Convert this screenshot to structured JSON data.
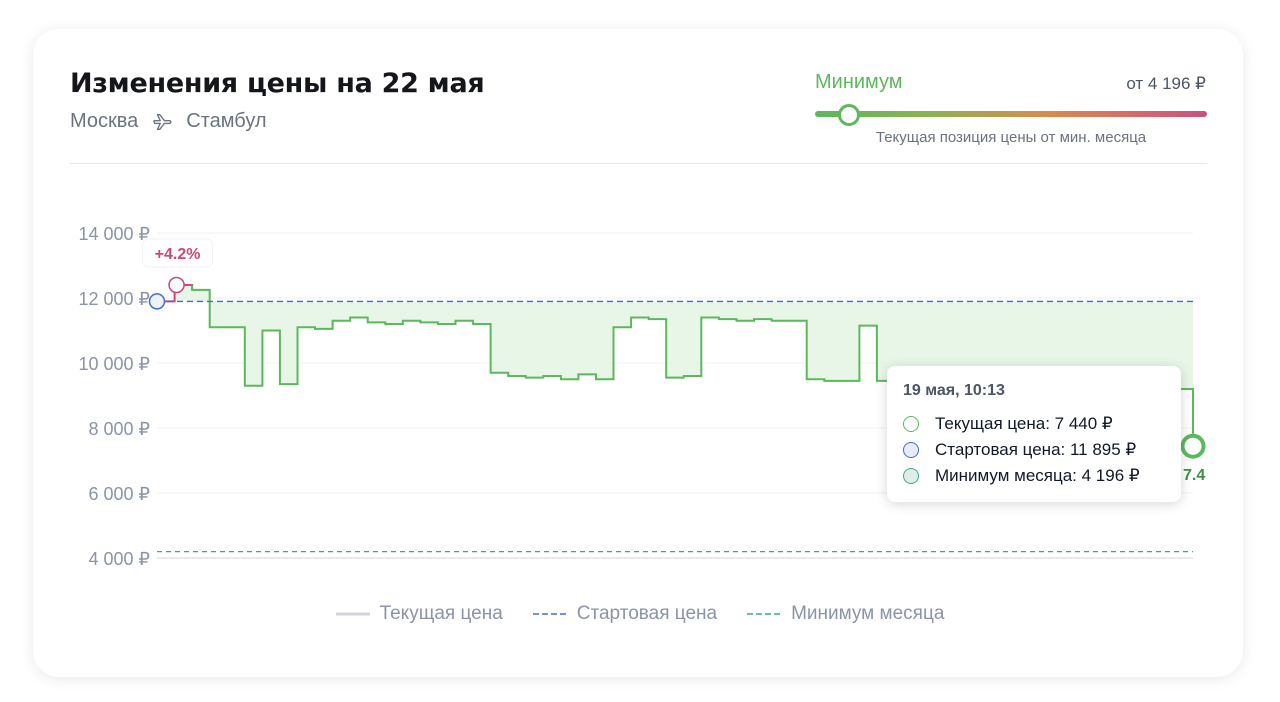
{
  "header": {
    "title": "Изменения цены на 22 мая",
    "route_from": "Москва",
    "route_to": "Стамбул"
  },
  "gauge": {
    "label": "Минимум",
    "value": "от 4 196 ₽",
    "caption": "Текущая позиция цены от мин. месяца",
    "position": 0.09
  },
  "chart_data": {
    "type": "line",
    "ylim": [
      4000,
      14000
    ],
    "y_ticks": [
      "14 000 ₽",
      "12 000 ₽",
      "10 000 ₽",
      "8 000 ₽",
      "6 000 ₽",
      "4 000 ₽"
    ],
    "start_price": 11895,
    "month_min": 4196,
    "change_badge": "+4.2%",
    "end_label": "7.4",
    "series": [
      {
        "name": "Текущая цена",
        "values": [
          11895,
          12400,
          12250,
          11100,
          11100,
          9300,
          11000,
          9350,
          11100,
          11050,
          11300,
          11400,
          11250,
          11200,
          11300,
          11250,
          11200,
          11300,
          11200,
          9700,
          9600,
          9550,
          9600,
          9500,
          9650,
          9500,
          11100,
          11400,
          11350,
          9550,
          9600,
          11400,
          11350,
          11300,
          11350,
          11300,
          11300,
          9500,
          9450,
          9450,
          11150,
          9450,
          9450,
          9500,
          9550,
          9550,
          9550,
          9550,
          7800,
          7780,
          7760,
          7760,
          9200,
          7900,
          8600,
          7950,
          7950,
          9500,
          9200,
          7440
        ]
      }
    ],
    "legend": [
      "Текущая цена",
      "Стартовая цена",
      "Минимум месяца"
    ],
    "colors": {
      "current": "#5cb85c",
      "rise": "#c94876",
      "start": "#3b6fd6",
      "min": "#3aa98a",
      "fill": "#e3f4e3"
    }
  },
  "tooltip": {
    "title": "19 мая, 10:13",
    "rows": [
      "Текущая цена: 7 440 ₽",
      "Стартовая цена: 11 895 ₽",
      "Минимум месяца: 4 196 ₽"
    ]
  }
}
